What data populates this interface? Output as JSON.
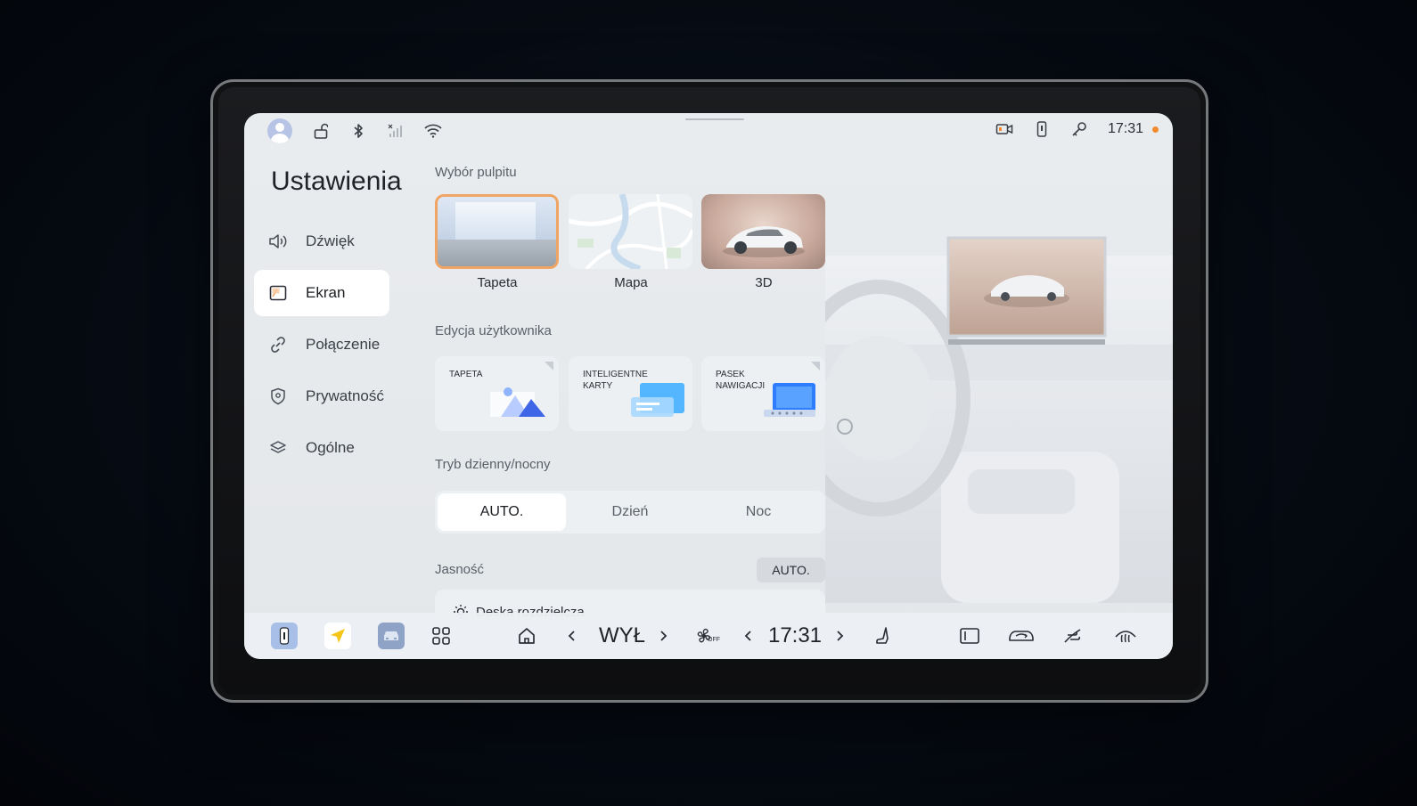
{
  "status_bar": {
    "time": "17:31",
    "icons": [
      "avatar",
      "unlock-icon",
      "bluetooth-icon",
      "signal-icon",
      "wifi-icon",
      "dashcam-icon",
      "phone-key-icon",
      "key-icon"
    ]
  },
  "sidebar": {
    "title": "Ustawienia",
    "items": [
      {
        "label": "Dźwięk",
        "icon": "speaker-icon"
      },
      {
        "label": "Ekran",
        "icon": "display-icon"
      },
      {
        "label": "Połączenie",
        "icon": "link-icon"
      },
      {
        "label": "Prywatność",
        "icon": "shield-icon"
      },
      {
        "label": "Ogólne",
        "icon": "layers-icon"
      }
    ],
    "active": "Ekran"
  },
  "desktop_selection": {
    "label": "Wybór pulpitu",
    "options": [
      {
        "label": "Tapeta"
      },
      {
        "label": "Mapa"
      },
      {
        "label": "3D"
      }
    ],
    "selected": "Tapeta"
  },
  "user_edit": {
    "label": "Edycja użytkownika",
    "cards": [
      {
        "label": "TAPETA"
      },
      {
        "label": "INTELIGENTNE KARTY"
      },
      {
        "label": "PASEK NAWIGACJI"
      }
    ]
  },
  "day_night": {
    "label": "Tryb dzienny/nocny",
    "options": [
      "AUTO.",
      "Dzień",
      "Noc"
    ],
    "selected": "AUTO."
  },
  "brightness": {
    "label": "Jasność",
    "auto_label": "AUTO.",
    "row_label": "Deska rozdzielcza"
  },
  "dock": {
    "climate_value": "WYŁ",
    "time": "17:31",
    "fan_label": "OFF"
  },
  "colors": {
    "accent": "#f0a565",
    "status_dot": "#f28a2e",
    "nav_app": "#f5c518",
    "background": "#e7eaed"
  }
}
